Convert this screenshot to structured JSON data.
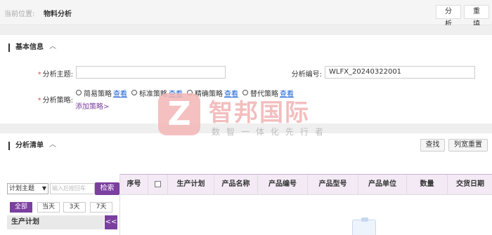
{
  "header": {
    "location_label": "当前位置:",
    "location_value": "物料分析",
    "analyze_label": "分析",
    "reset_label": "重填"
  },
  "basic": {
    "title": "基本信息",
    "chevron": "︿",
    "subject_label": "分析主题:",
    "subject_value": "",
    "code_label": "分析编号:",
    "code_value": "WLFX_20240322001",
    "strategy_label": "分析策略:",
    "strategies": [
      {
        "label": "简易策略",
        "link": "查看"
      },
      {
        "label": "标准策略",
        "link": "查看"
      },
      {
        "label": "精确策略",
        "link": "查看"
      },
      {
        "label": "替代策略",
        "link": "查看"
      }
    ],
    "add_strategy": "添加策略>"
  },
  "list": {
    "title": "分析清单",
    "chevron": "︿",
    "find_label": "查找",
    "reset_width_label": "列宽重置",
    "filter_select": "计划主题",
    "keyword_placeholder": "输入后按回车",
    "search_label": "检索",
    "day_buttons": [
      "全部",
      "当天",
      "3天",
      "7天"
    ],
    "plan_header": "生产计划",
    "collapse_label": "<<",
    "columns": [
      "序号",
      "",
      "生产计划",
      "产品名称",
      "产品编号",
      "产品型号",
      "产品单位",
      "数量",
      "交货日期"
    ]
  },
  "watermark": {
    "logo_letter": "Z",
    "main": "智邦国际",
    "sub": "数智一体化先行者"
  },
  "colors": {
    "accent": "#7b3fa0",
    "link": "#1a5fd0",
    "required": "#d9534f"
  }
}
